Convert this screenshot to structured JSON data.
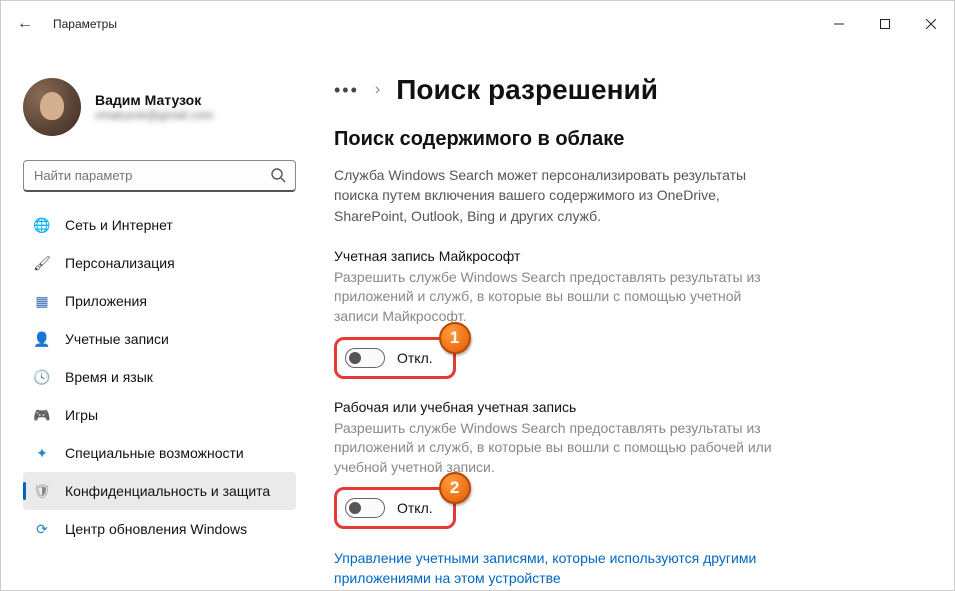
{
  "app_title": "Параметры",
  "profile": {
    "name": "Вадим Матузок",
    "email": "vmatuzok@gmail.com"
  },
  "search_placeholder": "Найти параметр",
  "nav": {
    "items": [
      {
        "icon": "🌐",
        "icon_name": "network-icon",
        "label": "Сеть и Интернет",
        "color": "#1e90ff"
      },
      {
        "icon": "🖌",
        "icon_name": "personalization-icon",
        "label": "Персонализация",
        "color": "#444"
      },
      {
        "icon": "▦",
        "icon_name": "apps-icon",
        "label": "Приложения",
        "color": "#3a6fb0"
      },
      {
        "icon": "👤",
        "icon_name": "accounts-icon",
        "label": "Учетные записи",
        "color": "#2e9e6f"
      },
      {
        "icon": "🕓",
        "icon_name": "time-language-icon",
        "label": "Время и язык",
        "color": "#3a85c9"
      },
      {
        "icon": "🎮",
        "icon_name": "gaming-icon",
        "label": "Игры",
        "color": "#777"
      },
      {
        "icon": "✦",
        "icon_name": "accessibility-icon",
        "label": "Специальные возможности",
        "color": "#2a86c7"
      },
      {
        "icon": "🛡",
        "icon_name": "privacy-icon",
        "label": "Конфиденциальность и защита",
        "color": "#888",
        "selected": true
      },
      {
        "icon": "⟳",
        "icon_name": "update-icon",
        "label": "Центр обновления Windows",
        "color": "#2a86c7"
      }
    ]
  },
  "breadcrumb": {
    "page_title": "Поиск разрешений"
  },
  "section": {
    "title": "Поиск содержимого в облаке",
    "desc": "Служба Windows Search может персонализировать результаты поиска путем включения вашего содержимого из OneDrive, SharePoint, Outlook, Bing и других служб."
  },
  "settings": [
    {
      "label": "Учетная запись Майкрософт",
      "desc": "Разрешить службе Windows Search предоставлять результаты из приложений и служб, в которые вы вошли с помощью учетной записи Майкрософт.",
      "state": "Откл.",
      "badge": "1"
    },
    {
      "label": "Рабочая или учебная учетная запись",
      "desc": "Разрешить службе Windows Search предоставлять результаты из приложений и служб, в которые вы вошли с помощью рабочей или учебной учетной записи.",
      "state": "Откл.",
      "badge": "2"
    }
  ],
  "link": "Управление учетными записями, которые используются другими приложениями на этом устройстве"
}
